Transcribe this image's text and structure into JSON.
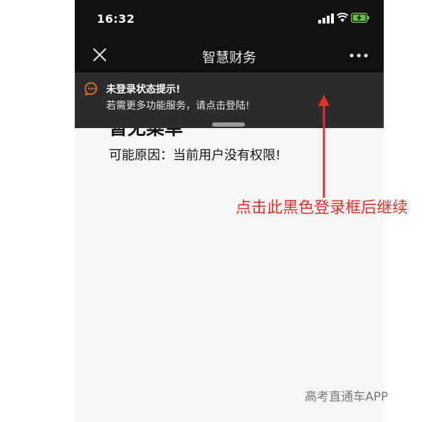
{
  "status_bar": {
    "time": "16:32"
  },
  "header": {
    "title": "智慧财务"
  },
  "banner": {
    "title": "未登录状态提示!",
    "message": "若需更多功能服务，请点击登陆!"
  },
  "content": {
    "title": "暂无菜单",
    "reason": "可能原因：当前用户没有权限!"
  },
  "annotation": {
    "text": "点击此黑色登录框后继续",
    "color": "#e3302a"
  },
  "watermark": "高考直通车APP"
}
